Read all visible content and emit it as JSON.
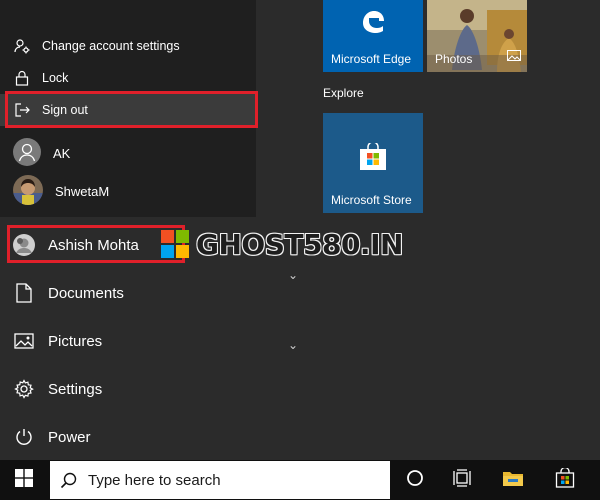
{
  "account_menu": {
    "change_settings": "Change account settings",
    "lock": "Lock",
    "sign_out": "Sign out",
    "users": [
      {
        "name": "AK"
      },
      {
        "name": "ShwetaM"
      }
    ]
  },
  "nav": {
    "user": "Ashish Mohta",
    "documents": "Documents",
    "pictures": "Pictures",
    "settings": "Settings",
    "power": "Power"
  },
  "tiles": {
    "edge": "Microsoft Edge",
    "photos": "Photos",
    "section_explore": "Explore",
    "store": "Microsoft Store"
  },
  "watermark": "GHOST580.IN",
  "taskbar": {
    "search_placeholder": "Type here to search"
  },
  "colors": {
    "highlight": "#e0202a",
    "tile_blue": "#0063b1",
    "tile_store": "#1c5a8a"
  }
}
